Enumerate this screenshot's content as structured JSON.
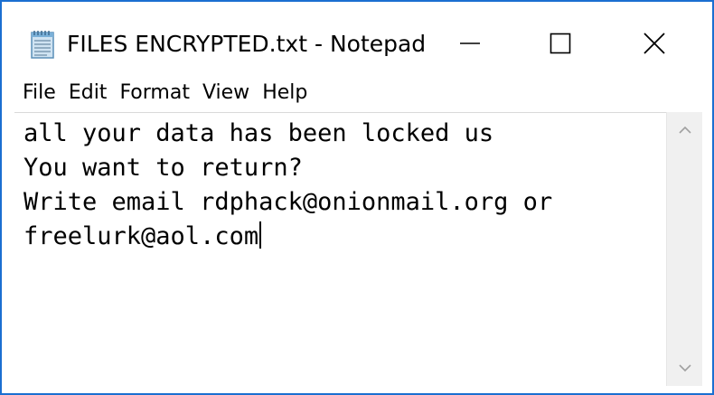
{
  "window": {
    "title": "FILES ENCRYPTED.txt - Notepad",
    "border_color": "#1b6fd1",
    "icon": "notepad-icon",
    "controls": [
      "minimize-icon",
      "maximize-icon",
      "close-icon"
    ]
  },
  "menu": {
    "items": [
      {
        "label": "File"
      },
      {
        "label": "Edit"
      },
      {
        "label": "Format"
      },
      {
        "label": "View"
      },
      {
        "label": "Help"
      }
    ]
  },
  "document": {
    "lines": [
      "all your data has been locked us",
      "You want to return?",
      "Write email rdphack@onionmail.org or",
      "freelurk@aol.com"
    ]
  },
  "scrollbar": {
    "up_icon": "chevron-up-icon",
    "down_icon": "chevron-down-icon"
  }
}
